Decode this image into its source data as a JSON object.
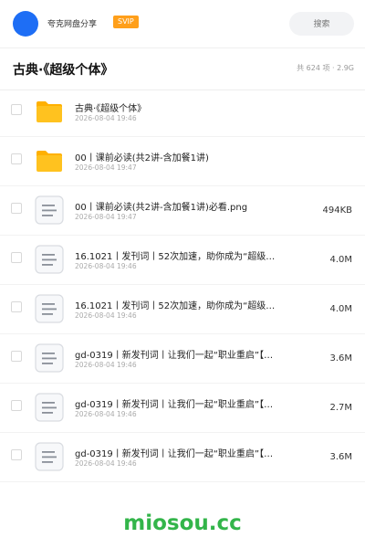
{
  "header": {
    "username": "夸克网盘分享",
    "badge": "SVIP",
    "search_placeholder": "搜索"
  },
  "folder": {
    "title": "古典·《超级个体》",
    "meta": "共 624 项 · 2.9G"
  },
  "files": [
    {
      "type": "folder",
      "name": "古典·《超级个体》",
      "date": "2026-08-04 19:46",
      "size": ""
    },
    {
      "type": "folder",
      "name": "00丨课前必读(共2讲-含加餐1讲)",
      "date": "2026-08-04 19:47",
      "size": ""
    },
    {
      "type": "file",
      "name": "00丨课前必读(共2讲-含加餐1讲)必看.png",
      "date": "2026-08-04 19:47",
      "size": "494KB"
    },
    {
      "type": "file",
      "name": "16.1021丨发刊词丨52次加速，助你成为“超级…",
      "date": "2026-08-04 19:46",
      "size": "4.0M"
    },
    {
      "type": "file",
      "name": "16.1021丨发刊词丨52次加速，助你成为“超级…",
      "date": "2026-08-04 19:46",
      "size": "4.0M"
    },
    {
      "type": "file",
      "name": "gd-0319丨新发刊词丨让我们一起“职业重启”【…",
      "date": "2026-08-04 19:46",
      "size": "3.6M"
    },
    {
      "type": "file",
      "name": "gd-0319丨新发刊词丨让我们一起“职业重启”【…",
      "date": "2026-08-04 19:46",
      "size": "2.7M"
    },
    {
      "type": "file",
      "name": "gd-0319丨新发刊词丨让我们一起“职业重启”【…",
      "date": "2026-08-04 19:46",
      "size": "3.6M"
    }
  ],
  "watermark": "miosou.cc",
  "colors": {
    "accent": "#1e6ef5",
    "badge": "#ff9f1a",
    "folder": "#ffc21f",
    "watermark": "#33b54a"
  }
}
